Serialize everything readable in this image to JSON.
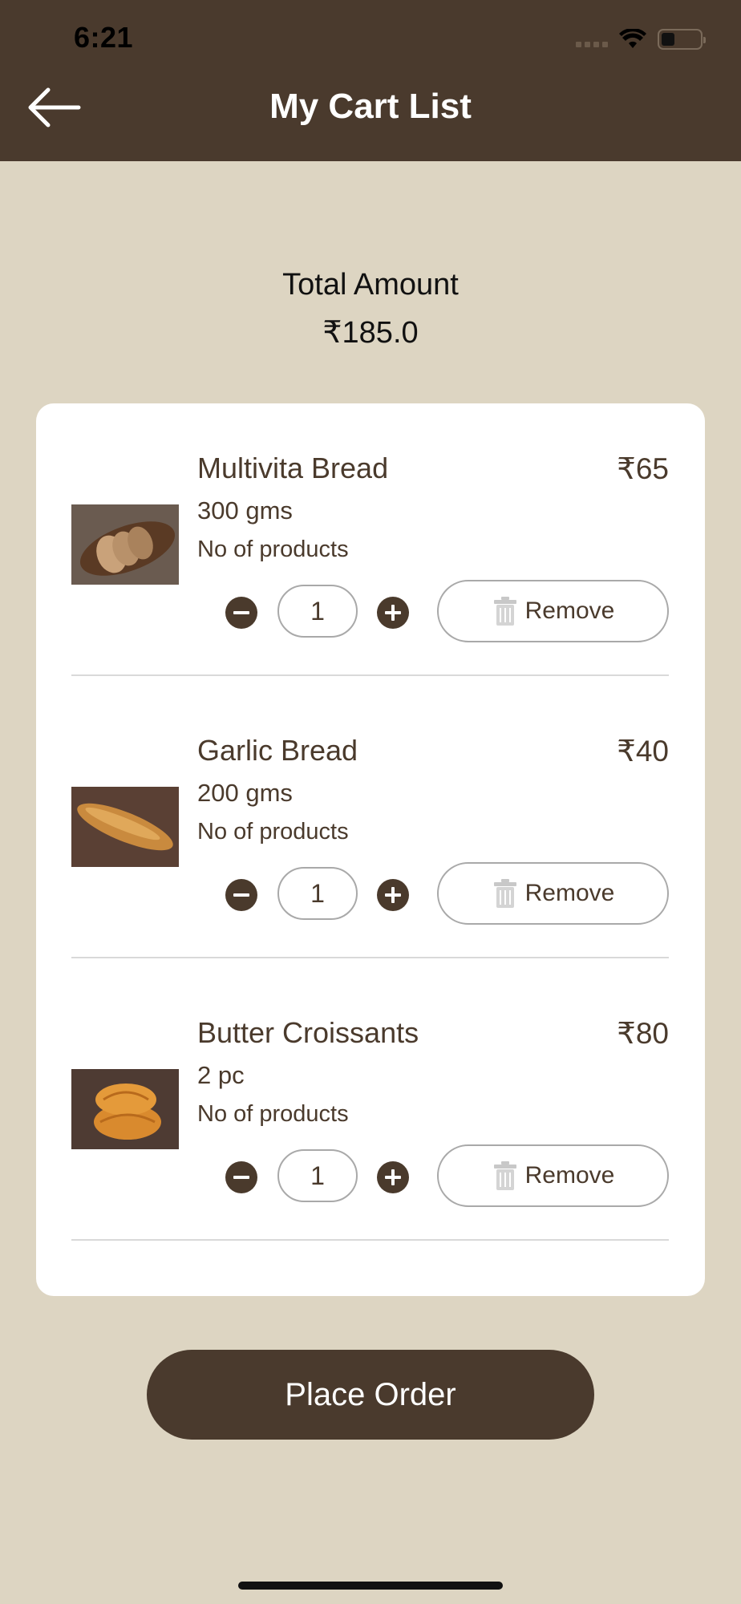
{
  "status_bar": {
    "time": "6:21"
  },
  "header": {
    "title": "My Cart List",
    "back_icon": "arrow-left-icon"
  },
  "summary": {
    "label": "Total Amount",
    "value": "₹185.0"
  },
  "items": [
    {
      "name": "Multivita Bread",
      "weight": "300 gms",
      "price": "₹65",
      "products_label": "No of products",
      "quantity": "1",
      "remove_label": "Remove",
      "image": "sliced-bread-loaf-image"
    },
    {
      "name": "Garlic Bread",
      "weight": "200 gms",
      "price": "₹40",
      "products_label": "No of products",
      "quantity": "1",
      "remove_label": "Remove",
      "image": "garlic-bread-image"
    },
    {
      "name": "Butter Croissants",
      "weight": "2 pc",
      "price": "₹80",
      "products_label": "No of products",
      "quantity": "1",
      "remove_label": "Remove",
      "image": "croissants-image"
    }
  ],
  "actions": {
    "place_order": "Place Order"
  },
  "colors": {
    "header_bg": "#4a3a2d",
    "page_bg": "#ddd5c2",
    "card_bg": "#ffffff",
    "text": "#4a3a2c",
    "button_bg": "#4a3a2d"
  }
}
